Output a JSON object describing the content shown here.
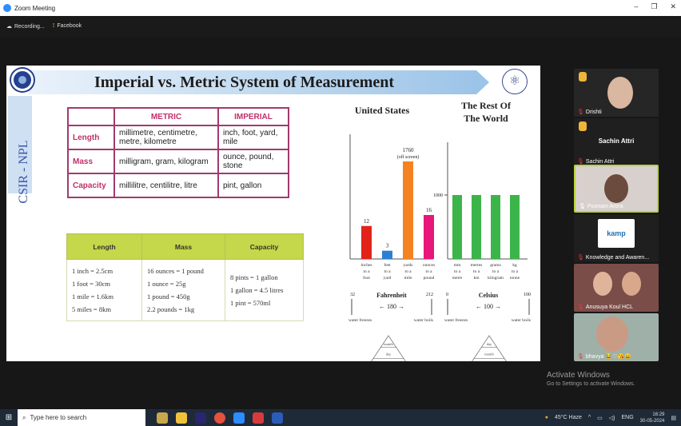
{
  "window": {
    "title": "Zoom Meeting"
  },
  "meeting_bar": {
    "recording": "Recording...",
    "facebook": "Facebook"
  },
  "slide": {
    "title": "Imperial vs. Metric System of Measurement",
    "side_label": "CSIR - NPL",
    "table": {
      "headers": [
        "",
        "METRIC",
        "IMPERIAL"
      ],
      "rows": [
        {
          "quantity": "Length",
          "metric": "millimetre, centimetre, metre, kilometre",
          "imperial": "inch, foot, yard, mile"
        },
        {
          "quantity": "Mass",
          "metric": "milligram, gram, kilogram",
          "imperial": "ounce, pound, stone"
        },
        {
          "quantity": "Capacity",
          "metric": "millilitre, centilitre, litre",
          "imperial": "pint, gallon"
        }
      ]
    },
    "conversions": {
      "headers": [
        "Length",
        "Mass",
        "Capacity"
      ],
      "length": [
        "1 inch = 2.5cm",
        "1 foot = 30cm",
        "1 mile = 1.6km",
        "5 miles = 8km"
      ],
      "mass": [
        "16 ounces = 1 pound",
        "1 ounce = 25g",
        "1 pound = 450g",
        "2.2 pounds = 1kg"
      ],
      "capacity": [
        "8 pints = 1 gallon",
        "1 gallon = 4.5 litres",
        "1 pint = 570ml"
      ]
    }
  },
  "chart_data": [
    {
      "type": "bar",
      "title": "United States",
      "categories": [
        "inches to a foot",
        "feet to a yard",
        "yards to a mile",
        "ounces to a pound"
      ],
      "values": [
        12,
        3,
        1760,
        16
      ],
      "data_labels": [
        "12",
        "3",
        "1760 (off screen)",
        "16"
      ],
      "colors": [
        "#e2231a",
        "#2d7fd3",
        "#f58220",
        "#e8157a"
      ],
      "ylim": [
        0,
        32
      ]
    },
    {
      "type": "bar",
      "title": "The Rest Of The World",
      "categories": [
        "mm to a metre",
        "metres to a km",
        "grams to a kilogram",
        "kg to a tonne"
      ],
      "values": [
        1000,
        1000,
        1000,
        1000
      ],
      "data_labels": [
        "1000"
      ],
      "colors": [
        "#3bb54a"
      ],
      "ylim": [
        0,
        1000
      ]
    }
  ],
  "temperature_scales": {
    "fahrenheit": {
      "name": "Fahrenheit",
      "low": "32",
      "high": "212",
      "span": "180",
      "low_note": "water freezes",
      "high_note": "water boils"
    },
    "celsius": {
      "name": "Celsius",
      "low": "0",
      "high": "100",
      "span": "100",
      "low_note": "water freezes",
      "high_note": "water boils"
    }
  },
  "date_pyramids": {
    "us": [
      "month",
      "day",
      "year"
    ],
    "world": [
      "day",
      "month",
      "year"
    ]
  },
  "participants": [
    {
      "name": "Drishti"
    },
    {
      "name": "Sachin Attri",
      "display": "Sachin Attri"
    },
    {
      "name": "Poonam Arora"
    },
    {
      "name": "Knowledge and Awaren...",
      "logo_text": "kamp"
    },
    {
      "name": "Anusuya Koul HCL"
    },
    {
      "name": "bhavya 😂♡😘😀"
    }
  ],
  "activation": {
    "title": "Activate Windows",
    "subtitle": "Go to Settings to activate Windows."
  },
  "taskbar": {
    "search_placeholder": "Type here to search",
    "weather": "45°C Haze",
    "lang": "ENG",
    "time": "16:29",
    "date": "30-05-2024"
  },
  "colors": {
    "table_border": "#a13a6e",
    "table_header": "#c1306a",
    "conv_header": "#c5d74a",
    "active_speaker": "#b8d43a"
  }
}
